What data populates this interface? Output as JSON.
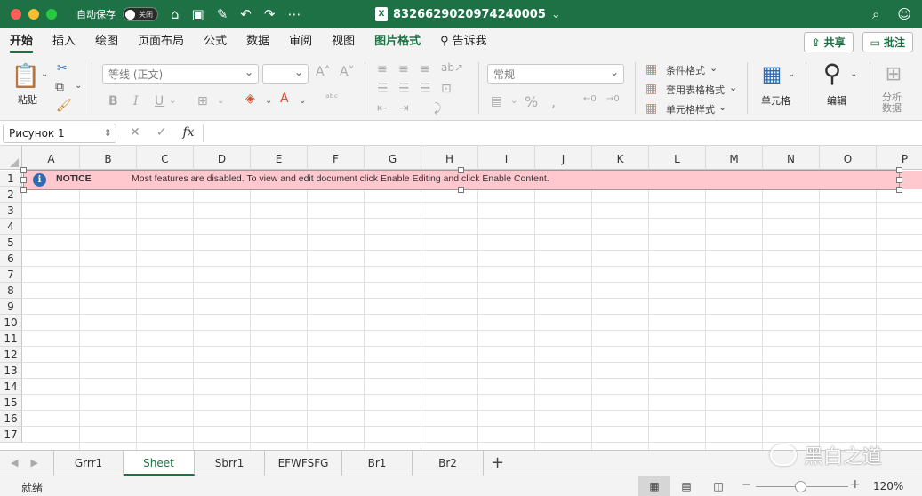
{
  "window": {
    "autosave_label": "自动保存",
    "autosave_toggle": "关闭",
    "doc_title": "8326629020974240005",
    "doc_chevron": "⌄"
  },
  "tabs": [
    {
      "label": "开始"
    },
    {
      "label": "插入"
    },
    {
      "label": "绘图"
    },
    {
      "label": "页面布局"
    },
    {
      "label": "公式"
    },
    {
      "label": "数据"
    },
    {
      "label": "审阅"
    },
    {
      "label": "视图"
    },
    {
      "label": "图片格式"
    },
    {
      "label": "告诉我"
    }
  ],
  "share": {
    "share_label": "共享",
    "comment_label": "批注"
  },
  "ribbon": {
    "paste_label": "粘贴",
    "font_name": "等线 (正文)",
    "font_size": "",
    "number_format": "常规",
    "conditional_format": "条件格式",
    "table_format": "套用表格格式",
    "cell_style": "单元格样式",
    "cells_label": "单元格",
    "edit_label": "编辑",
    "analyze_label": "分析\n数据",
    "bold": "B",
    "italic": "I",
    "underline": "U",
    "percent": "%"
  },
  "formula_bar": {
    "name_box": "Рисунок 1",
    "fx": "fx"
  },
  "grid": {
    "columns": [
      "A",
      "B",
      "C",
      "D",
      "E",
      "F",
      "G",
      "H",
      "I",
      "J",
      "K",
      "L",
      "M",
      "N",
      "O",
      "P"
    ],
    "rows": [
      "1",
      "2",
      "3",
      "4",
      "5",
      "6",
      "7",
      "8",
      "9",
      "10",
      "11",
      "12",
      "13",
      "14",
      "15",
      "16",
      "17"
    ]
  },
  "notice": {
    "icon": "i",
    "title": "NOTICE",
    "message": "Most features are disabled. To view and edit document click Enable Editing and click Enable Content."
  },
  "sheets": [
    {
      "name": "Grrr1"
    },
    {
      "name": "Sheet"
    },
    {
      "name": "Sbrr1"
    },
    {
      "name": "EFWFSFG"
    },
    {
      "name": "Br1"
    },
    {
      "name": "Br2"
    }
  ],
  "sheet_add": "+",
  "status": {
    "ready": "就绪",
    "zoom": "120%"
  },
  "watermark": {
    "text": "黑白之道"
  }
}
